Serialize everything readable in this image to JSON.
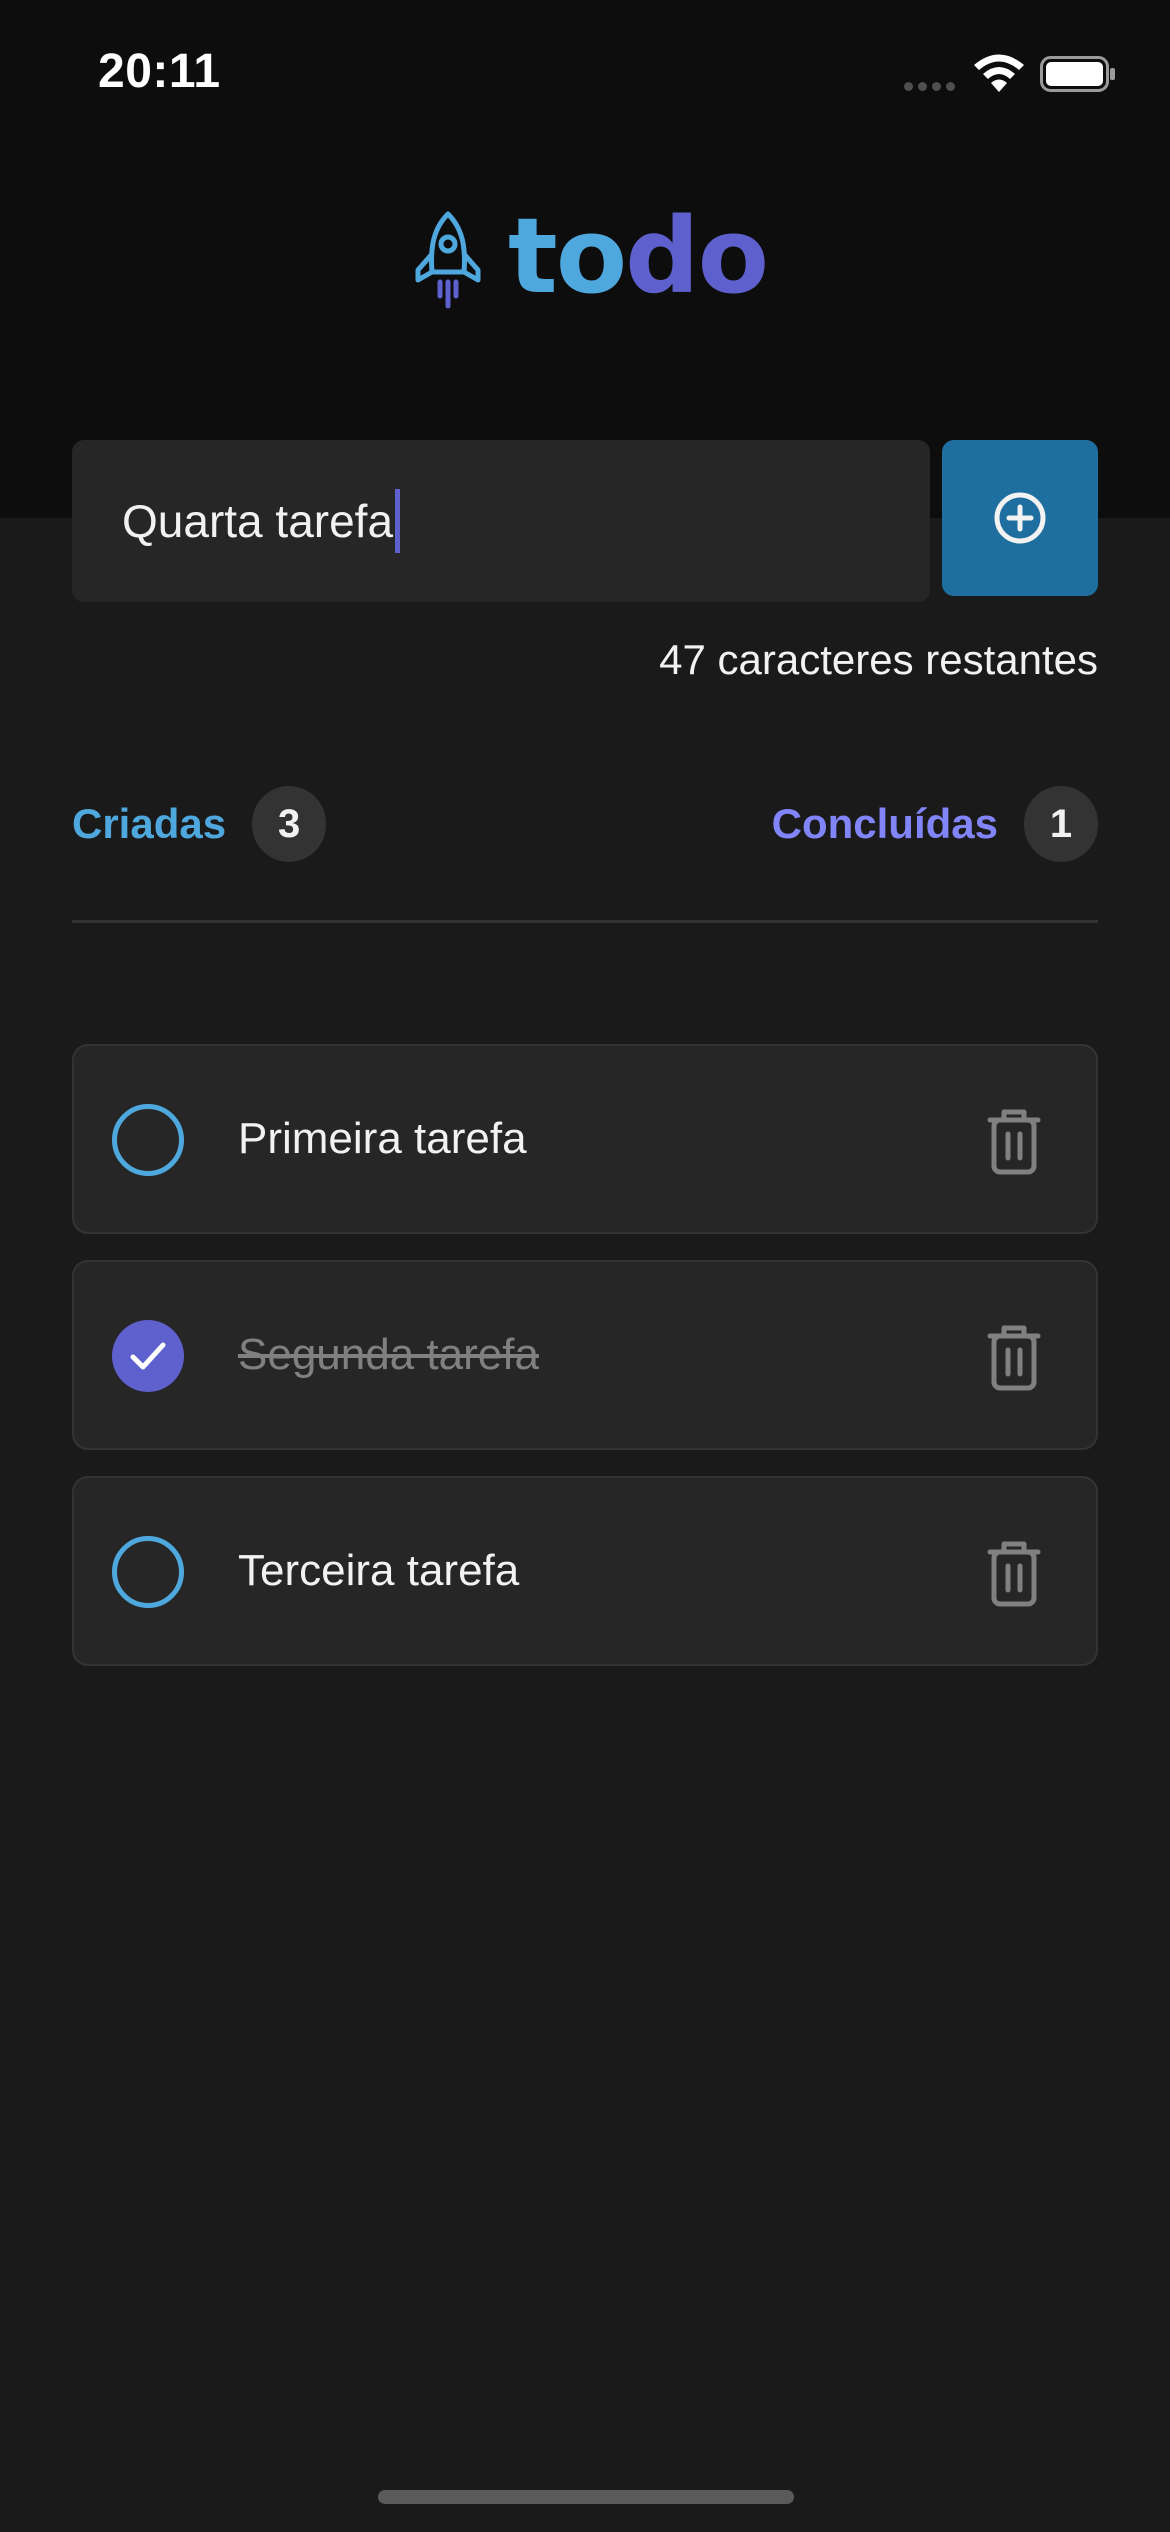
{
  "status_bar": {
    "time": "20:11"
  },
  "logo": {
    "text_part_1": "to",
    "text_part_2": "do"
  },
  "new_task": {
    "value": "Quarta tarefa"
  },
  "remaining_chars": "47 caracteres restantes",
  "counters": {
    "created_label": "Criadas",
    "created_count": "3",
    "done_label": "Concluídas",
    "done_count": "1"
  },
  "tasks": [
    {
      "title": "Primeira tarefa",
      "done": false
    },
    {
      "title": "Segunda tarefa",
      "done": true
    },
    {
      "title": "Terceira tarefa",
      "done": false
    }
  ],
  "colors": {
    "blue": "#4ea8de",
    "blue_dark": "#1e6f9f",
    "purple": "#5e60ce",
    "purple_light": "#8284fa",
    "background": "#1a1a1a",
    "header": "#0d0d0d"
  },
  "icons": [
    "rocket-icon",
    "plus-circle-icon",
    "check-icon",
    "trash-icon",
    "wifi-icon",
    "battery-icon"
  ]
}
